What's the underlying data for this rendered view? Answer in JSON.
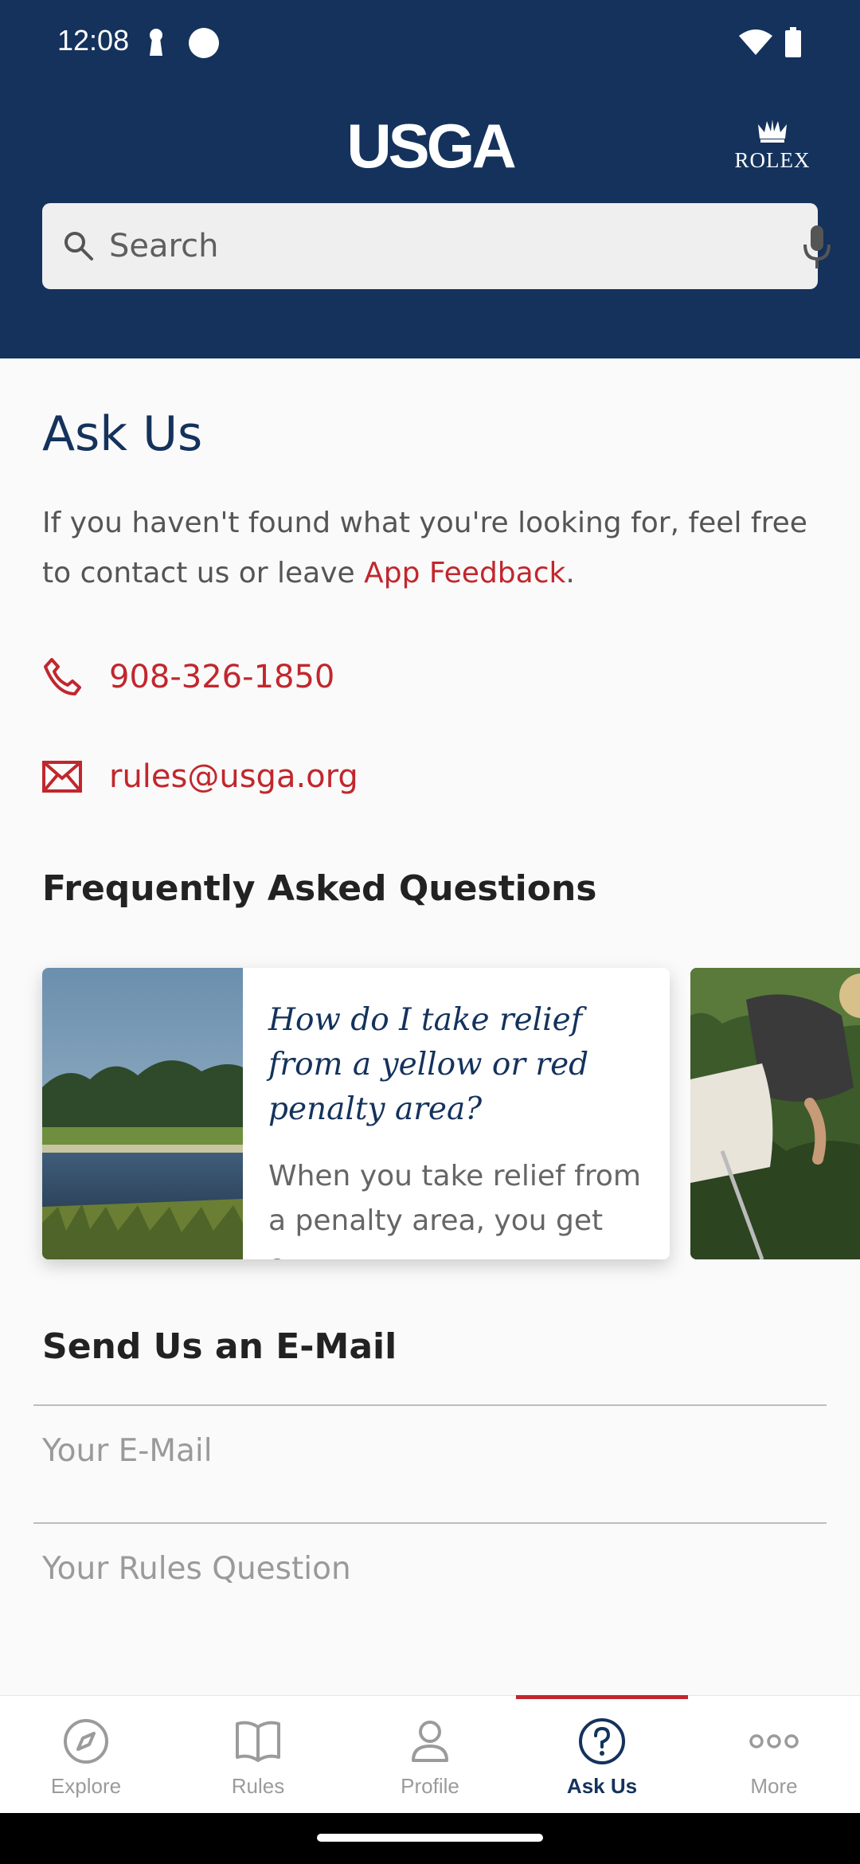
{
  "status_bar": {
    "time": "12:08"
  },
  "header": {
    "logo": "USGA",
    "sponsor": "ROLEX"
  },
  "search": {
    "placeholder": "Search"
  },
  "ask_us": {
    "title": "Ask Us",
    "intro_prefix": "If you haven't found what you're looking for, feel free to contact us or leave ",
    "feedback_link": "App Feedback",
    "intro_suffix": ".",
    "phone": "908-326-1850",
    "email": "rules@usga.org"
  },
  "faq": {
    "title": "Frequently Asked Questions",
    "cards": [
      {
        "question": "How do I take relief from a yellow or red penalty area?",
        "excerpt": "When you take relief from a penalty area, you get o…"
      }
    ]
  },
  "email_form": {
    "title": "Send Us an E-Mail",
    "email_placeholder": "Your E-Mail",
    "question_placeholder": "Your Rules Question"
  },
  "bottom_nav": [
    {
      "label": "Explore",
      "icon": "compass-icon",
      "active": false
    },
    {
      "label": "Rules",
      "icon": "book-icon",
      "active": false
    },
    {
      "label": "Profile",
      "icon": "person-icon",
      "active": false
    },
    {
      "label": "Ask Us",
      "icon": "question-circle-icon",
      "active": true
    },
    {
      "label": "More",
      "icon": "more-dots-icon",
      "active": false
    }
  ],
  "colors": {
    "navy": "#14325c",
    "red_accent": "#c1272d",
    "inactive": "#9b9b9b"
  }
}
